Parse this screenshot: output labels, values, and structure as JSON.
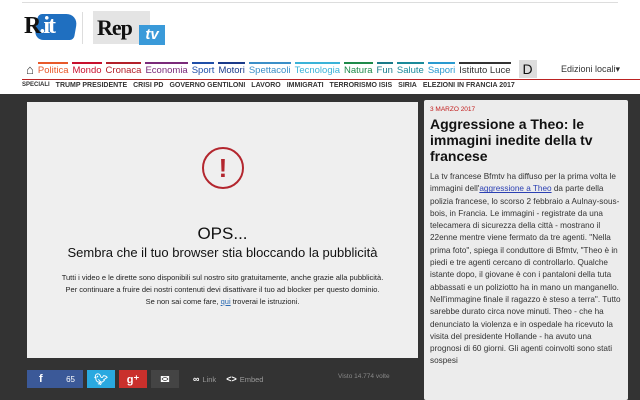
{
  "header": {
    "logo_rit": "R.it",
    "logo_rep": "Rep",
    "logo_tv": "tv"
  },
  "nav": {
    "items": [
      {
        "label": "Politica",
        "color": "#e8592a"
      },
      {
        "label": "Mondo",
        "color": "#c8102e"
      },
      {
        "label": "Cronaca",
        "color": "#b3202a"
      },
      {
        "label": "Economia",
        "color": "#7a2a7a"
      },
      {
        "label": "Sport",
        "color": "#1e4ea8"
      },
      {
        "label": "Motori",
        "color": "#1a3a8a"
      },
      {
        "label": "Spettacoli",
        "color": "#3b8fc8"
      },
      {
        "label": "Tecnologia",
        "color": "#3bb3d8"
      },
      {
        "label": "Natura",
        "color": "#1e8a4a"
      },
      {
        "label": "Fun",
        "color": "#1a7a8a"
      },
      {
        "label": "Salute",
        "color": "#1a8a9a"
      },
      {
        "label": "Sapori",
        "color": "#2a9ad0"
      },
      {
        "label": "Istituto Luce",
        "color": "#333333"
      }
    ],
    "d_label": "D",
    "editions": "Edizioni locali▾"
  },
  "specials": [
    "SPECIALI",
    "TRUMP PRESIDENTE",
    "CRISI PD",
    "GOVERNO GENTILONI",
    "LAVORO",
    "IMMIGRATI",
    "TERRORISMO ISIS",
    "SIRIA",
    "ELEZIONI IN FRANCIA 2017"
  ],
  "player": {
    "icon": "exclamation-icon",
    "title": "OPS...",
    "subtitle": "Sembra che il tuo browser stia bloccando la pubblicità",
    "line1": "Tutti i video e le dirette sono disponibili sul nostro sito gratuitamente, anche grazie alla pubblicità.",
    "line2": "Per continuare a fruire dei nostri contenuti devi disattivare il tuo ad blocker per questo dominio.",
    "line3a": "Se non sai come fare, ",
    "link": "qui",
    "line3b": " troverai le istruzioni."
  },
  "share": {
    "fb_count": "65",
    "link": "Link",
    "embed": "Embed",
    "views": "Visto 14.774 volte"
  },
  "article": {
    "date": "3 MARZO 2017",
    "title": "Aggressione a Theo: le immagini inedite della tv francese",
    "body_a": "La tv francese Bfmtv ha diffuso per la prima volta le immagini dell'",
    "body_link": "aggressione a Theo",
    "body_b": " da parte della polizia francese, lo scorso 2 febbraio a Aulnay-sous-bois, in Francia. Le immagini - registrate da una telecamera di sicurezza della città - mostrano il 22enne mentre viene fermato da tre agenti. \"Nella prima foto\", spiega il conduttore di Bfmtv, \"Theo è in piedi e tre agenti cercano di controllarlo. Qualche istante dopo, il giovane è con i pantaloni della tuta abbassati e un poliziotto ha in mano un manganello. Nell'immagine finale il ragazzo è steso a terra\". Tutto sarebbe durato circa nove minuti. Theo - che ha denunciato la violenza e in ospedale ha ricevuto la visita del presidente Hollande - ha avuto una prognosi di 60 giorni. Gli agenti coinvolti sono stati sospesi"
  }
}
